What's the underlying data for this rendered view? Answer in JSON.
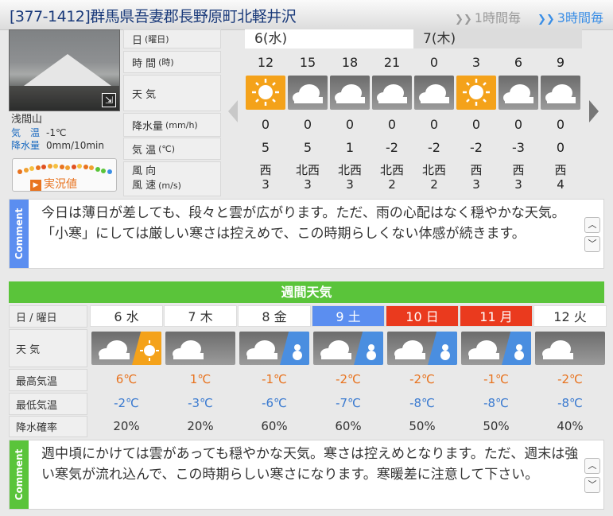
{
  "header": {
    "title": "[377-1412]群馬県吾妻郡長野原町北軽井沢",
    "mode_1h": "1時間毎",
    "mode_3h": "3時間毎"
  },
  "livecam": {
    "place": "浅間山",
    "temp_label": "気　温",
    "temp_value": "-1℃",
    "rain_label": "降水量",
    "rain_value": "0mm/10min",
    "button_label": "実況値"
  },
  "hourly": {
    "labels": {
      "day": "日",
      "day_sub": "(曜日)",
      "time": "時 間",
      "time_sub": "(時)",
      "weather": "天 気",
      "rain": "降水量",
      "rain_sub": "(mm/h)",
      "temp": "気 温",
      "temp_sub": "(℃)",
      "wind_dir": "風 向",
      "wind_speed": "風 速",
      "wind_sub": "(m/s)"
    },
    "days": [
      "6(水)",
      "7(木)"
    ],
    "hours": [
      "12",
      "15",
      "18",
      "21",
      "0",
      "3",
      "6",
      "9"
    ],
    "weather": [
      "sunny-icon",
      "cloudy-icon",
      "cloudy-icon",
      "cloudy-icon",
      "cloudy-icon",
      "sunny-icon",
      "cloudy-icon",
      "cloudy-icon"
    ],
    "rain": [
      "0",
      "0",
      "0",
      "0",
      "0",
      "0",
      "0",
      "0"
    ],
    "temp": [
      "5",
      "5",
      "1",
      "-2",
      "-2",
      "-2",
      "-3",
      "0"
    ],
    "wind_dir": [
      "西",
      "北西",
      "北西",
      "北西",
      "北西",
      "西",
      "西",
      "西"
    ],
    "wind_speed": [
      "3",
      "3",
      "3",
      "2",
      "2",
      "3",
      "3",
      "4"
    ]
  },
  "comment1": {
    "tag": "Comment",
    "text": "今日は薄日が差しても、段々と雲が広がります。ただ、雨の心配はなく穏やかな天気。「小寒」にしては厳しい寒さは控えめで、この時期らしくない体感が続きます。"
  },
  "weekly": {
    "title": "週間天気",
    "labels": {
      "day": "日 / 曜日",
      "weather": "天 気",
      "high": "最高気温",
      "low": "最低気温",
      "pop": "降水確率"
    },
    "days": [
      {
        "label": "6 水",
        "type": "weekday",
        "wx": "cloud-sun-icon",
        "high": "6℃",
        "low": "-2℃",
        "pop": "20%"
      },
      {
        "label": "7 木",
        "type": "weekday",
        "wx": "cloudy-icon",
        "high": "1℃",
        "low": "-3℃",
        "pop": "20%"
      },
      {
        "label": "8 金",
        "type": "weekday",
        "wx": "cloud-snow-icon",
        "high": "-1℃",
        "low": "-6℃",
        "pop": "60%"
      },
      {
        "label": "9 土",
        "type": "sat",
        "wx": "cloud-snow-icon",
        "high": "-2℃",
        "low": "-7℃",
        "pop": "60%"
      },
      {
        "label": "10 日",
        "type": "sun",
        "wx": "cloud-snow-icon",
        "high": "-2℃",
        "low": "-8℃",
        "pop": "50%"
      },
      {
        "label": "11 月",
        "type": "sun",
        "wx": "cloud-snow-icon",
        "high": "-1℃",
        "low": "-8℃",
        "pop": "50%"
      },
      {
        "label": "12 火",
        "type": "weekday",
        "wx": "cloudy-icon",
        "high": "-2℃",
        "low": "-8℃",
        "pop": "40%"
      }
    ]
  },
  "comment2": {
    "tag": "Comment",
    "text": "週中頃にかけては雲があっても穏やかな天気。寒さは控えめとなります。ただ、週末は強い寒気が流れ込んで、この時期らしい寒さになります。寒暖差に注意して下さい。"
  },
  "colors": {
    "comment_tag_blue": "#5b8ef0",
    "comment_tag_green": "#5ac43a",
    "sun_orange": "#f4a21a",
    "saturday_blue": "#5b8ef0",
    "holiday_red": "#ea3a1e"
  }
}
